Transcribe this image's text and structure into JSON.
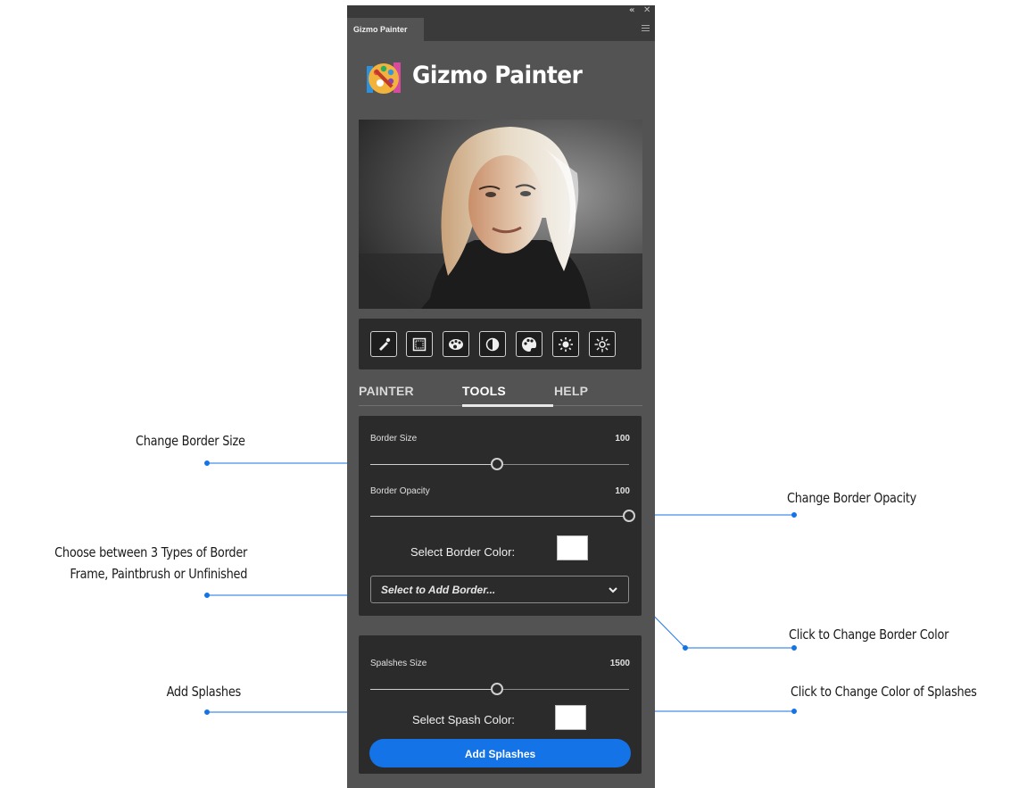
{
  "panel": {
    "tab_label": "Gizmo Painter",
    "collapse_glyph": "«",
    "close_glyph": "✕",
    "menu_icon": "hamburger-menu-icon"
  },
  "logo": {
    "title": "Gizmo Painter",
    "icon": "palette-icon"
  },
  "toolbar": {
    "tools": [
      {
        "icon": "brush-icon"
      },
      {
        "icon": "border-frame-icon"
      },
      {
        "icon": "palette-icon"
      },
      {
        "icon": "contrast-icon"
      },
      {
        "icon": "color-palette-icon"
      },
      {
        "icon": "brightness-low-icon"
      },
      {
        "icon": "brightness-high-icon"
      }
    ]
  },
  "tabs": [
    {
      "label": "PAINTER",
      "active": false
    },
    {
      "label": "TOOLS",
      "active": true
    },
    {
      "label": "HELP",
      "active": false
    }
  ],
  "border": {
    "size_label": "Border Size",
    "size_value": "100",
    "size_level": 0.49,
    "opacity_label": "Border Opacity",
    "opacity_value": "100",
    "opacity_level": 1.0,
    "color_label": "Select Border Color:",
    "color": "#ffffff",
    "select_placeholder": "Select to Add Border..."
  },
  "splashes": {
    "size_label": "Spalshes Size",
    "size_value": "1500",
    "size_level": 0.49,
    "color_label": "Select Spash Color:",
    "color": "#ffffff",
    "button_label": "Add Splashes"
  },
  "annotations": {
    "border_size": "Change Border Size",
    "border_opacity": "Change Border Opacity",
    "border_type_line1": "Choose between 3 Types of Border",
    "border_type_line2": "Frame, Paintbrush or Unfinished",
    "border_color": "Click to Change Border Color",
    "add_splashes": "Add Splashes",
    "splash_color": "Click to Change Color of Splashes"
  },
  "colors": {
    "accent": "#1473e6",
    "panel_bg": "#535353",
    "card_bg": "#2b2b2b",
    "callout_line": "#1473e6"
  }
}
